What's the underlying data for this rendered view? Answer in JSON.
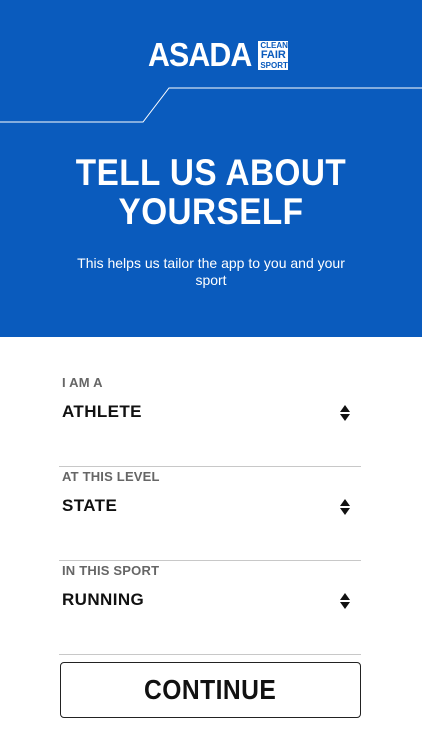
{
  "brand": {
    "logo_word": "ASADA",
    "logo_tag": [
      "CLEAN",
      "FAIR",
      "SPORT"
    ],
    "primary_color": "#0a5bbd"
  },
  "hero": {
    "title_line1": "TELL US ABOUT",
    "title_line2": "YOURSELF",
    "subtitle": "This helps us tailor the app to you and your sport"
  },
  "form": {
    "fields": [
      {
        "label": "I AM A",
        "value": "ATHLETE",
        "icon": "sort-arrows-icon"
      },
      {
        "label": "AT THIS LEVEL",
        "value": "STATE",
        "icon": "sort-arrows-icon"
      },
      {
        "label": "IN THIS SPORT",
        "value": "RUNNING",
        "icon": "sort-arrows-icon"
      }
    ]
  },
  "actions": {
    "continue_label": "CONTINUE"
  }
}
